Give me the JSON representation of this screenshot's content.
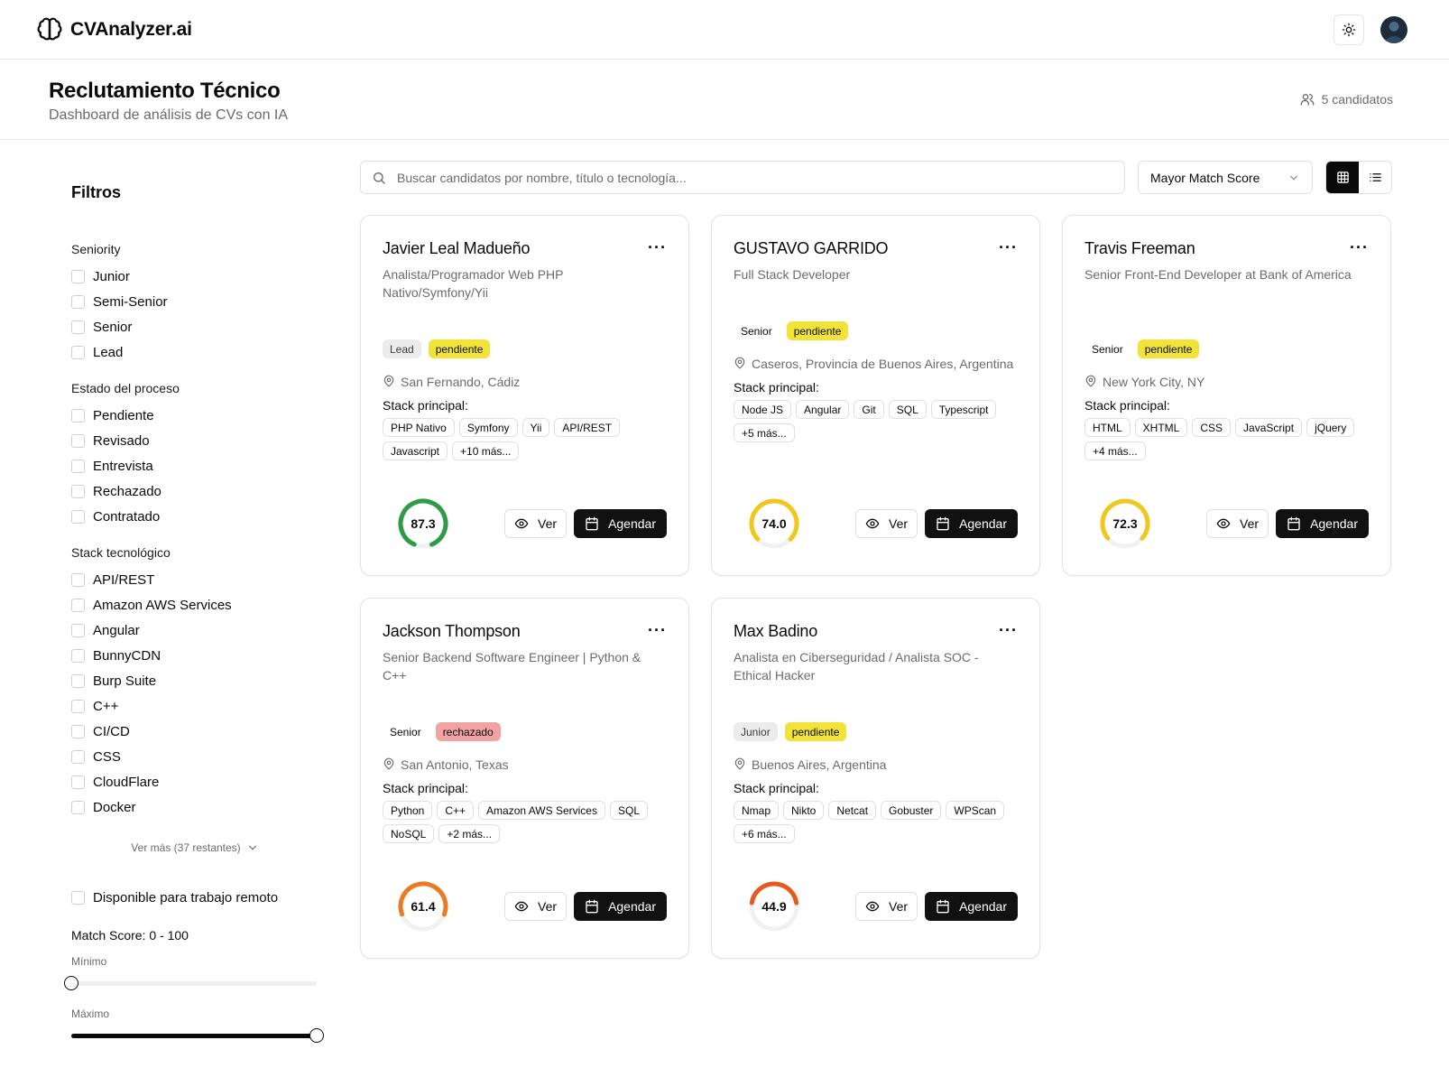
{
  "app": {
    "name": "CVAnalyzer.ai"
  },
  "page": {
    "title": "Reclutamiento Técnico",
    "subtitle": "Dashboard de análisis de CVs con IA",
    "candidate_count": "5 candidatos"
  },
  "sidebar": {
    "title": "Filtros",
    "seniority": {
      "title": "Seniority",
      "options": [
        "Junior",
        "Semi-Senior",
        "Senior",
        "Lead"
      ]
    },
    "status": {
      "title": "Estado del proceso",
      "options": [
        "Pendiente",
        "Revisado",
        "Entrevista",
        "Rechazado",
        "Contratado"
      ]
    },
    "stack": {
      "title": "Stack tecnológico",
      "options": [
        "API/REST",
        "Amazon AWS Services",
        "Angular",
        "BunnyCDN",
        "Burp Suite",
        "C++",
        "CI/CD",
        "CSS",
        "CloudFlare",
        "Docker"
      ]
    },
    "see_more": "Ver más (37 restantes)",
    "remote_label": "Disponible para trabajo remoto",
    "match_score": {
      "title": "Match Score: 0 - 100",
      "min_label": "Mínimo",
      "max_label": "Máximo",
      "min_value": 0,
      "max_value": 100
    }
  },
  "toolbar": {
    "search_placeholder": "Buscar candidatos por nombre, título o tecnología...",
    "sort_value": "Mayor Match Score"
  },
  "buttons": {
    "view": "Ver",
    "schedule": "Agendar"
  },
  "labels": {
    "stack": "Stack principal:"
  },
  "candidates": [
    {
      "name": "Javier Leal Madueño",
      "title": "Analista/Programador Web PHP Nativo/Symfony/Yii",
      "seniority": "Lead",
      "status": "pendiente",
      "location": "San Fernando, Cádiz",
      "stack": [
        "PHP Nativo",
        "Symfony",
        "Yii",
        "API/REST",
        "Javascript"
      ],
      "more": "+10 más...",
      "score": "87.3",
      "score_color": "#2e9c46",
      "seniority_style": "grey",
      "status_style": "yellow"
    },
    {
      "name": "GUSTAVO GARRIDO",
      "title": "Full Stack Developer",
      "seniority": "Senior",
      "status": "pendiente",
      "location": "Caseros, Provincia de Buenos Aires, Argentina",
      "stack": [
        "Node JS",
        "Angular",
        "Git",
        "SQL",
        "Typescript"
      ],
      "more": "+5 más...",
      "score": "74.0",
      "score_color": "#f0c71d",
      "seniority_style": "plain",
      "status_style": "yellow"
    },
    {
      "name": "Travis Freeman",
      "title": "Senior Front-End Developer at Bank of America",
      "seniority": "Senior",
      "status": "pendiente",
      "location": "New York City, NY",
      "stack": [
        "HTML",
        "XHTML",
        "CSS",
        "JavaScript",
        "jQuery"
      ],
      "more": "+4 más...",
      "score": "72.3",
      "score_color": "#f0c71d",
      "seniority_style": "plain",
      "status_style": "yellow"
    },
    {
      "name": "Jackson Thompson",
      "title": "Senior Backend Software Engineer | Python & C++",
      "seniority": "Senior",
      "status": "rechazado",
      "location": "San Antonio, Texas",
      "stack": [
        "Python",
        "C++",
        "Amazon AWS Services",
        "SQL",
        "NoSQL"
      ],
      "more": "+2 más...",
      "score": "61.4",
      "score_color": "#ea7b22",
      "seniority_style": "plain",
      "status_style": "red"
    },
    {
      "name": "Max Badino",
      "title": "Analista en Ciberseguridad / Analista SOC - Ethical Hacker",
      "seniority": "Junior",
      "status": "pendiente",
      "location": "Buenos Aires, Argentina",
      "stack": [
        "Nmap",
        "Nikto",
        "Netcat",
        "Gobuster",
        "WPScan"
      ],
      "more": "+6 más...",
      "score": "44.9",
      "score_color": "#e55a1e",
      "seniority_style": "grey",
      "status_style": "yellow"
    }
  ]
}
